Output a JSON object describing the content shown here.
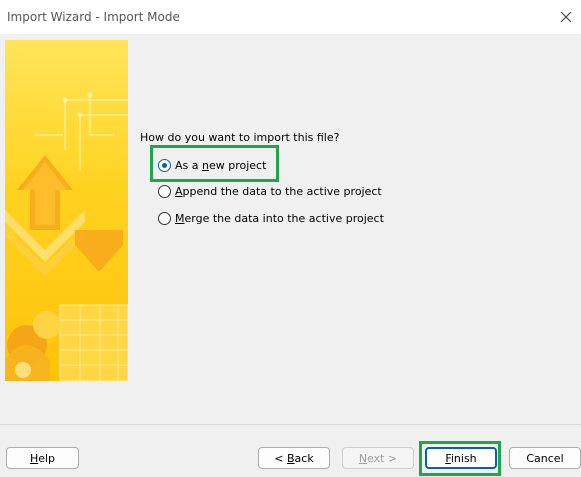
{
  "window": {
    "title": "Import Wizard - Import Mode",
    "close_icon": "close-icon"
  },
  "banner": {
    "icon": "import-wizard-banner-graphic",
    "accent": "#ffd21f"
  },
  "question": "How do you want to import this file?",
  "options": [
    {
      "pre": "As a ",
      "key": "n",
      "post": "ew project",
      "selected": true
    },
    {
      "pre": "",
      "key": "A",
      "post": "ppend the data to the active project",
      "selected": false
    },
    {
      "pre": "",
      "key": "M",
      "post": "erge the data into the active project",
      "selected": false
    }
  ],
  "buttons": {
    "help": {
      "key": "H",
      "post": "elp"
    },
    "back": {
      "pre": "< ",
      "key": "B",
      "post": "ack"
    },
    "next": {
      "pre": "",
      "key": "N",
      "post": "ext >"
    },
    "finish": {
      "key": "F",
      "post": "inish"
    },
    "cancel": {
      "label": "Cancel"
    }
  },
  "colors": {
    "highlight": "#21a54a",
    "radio_selected": "#0a5fb4"
  }
}
